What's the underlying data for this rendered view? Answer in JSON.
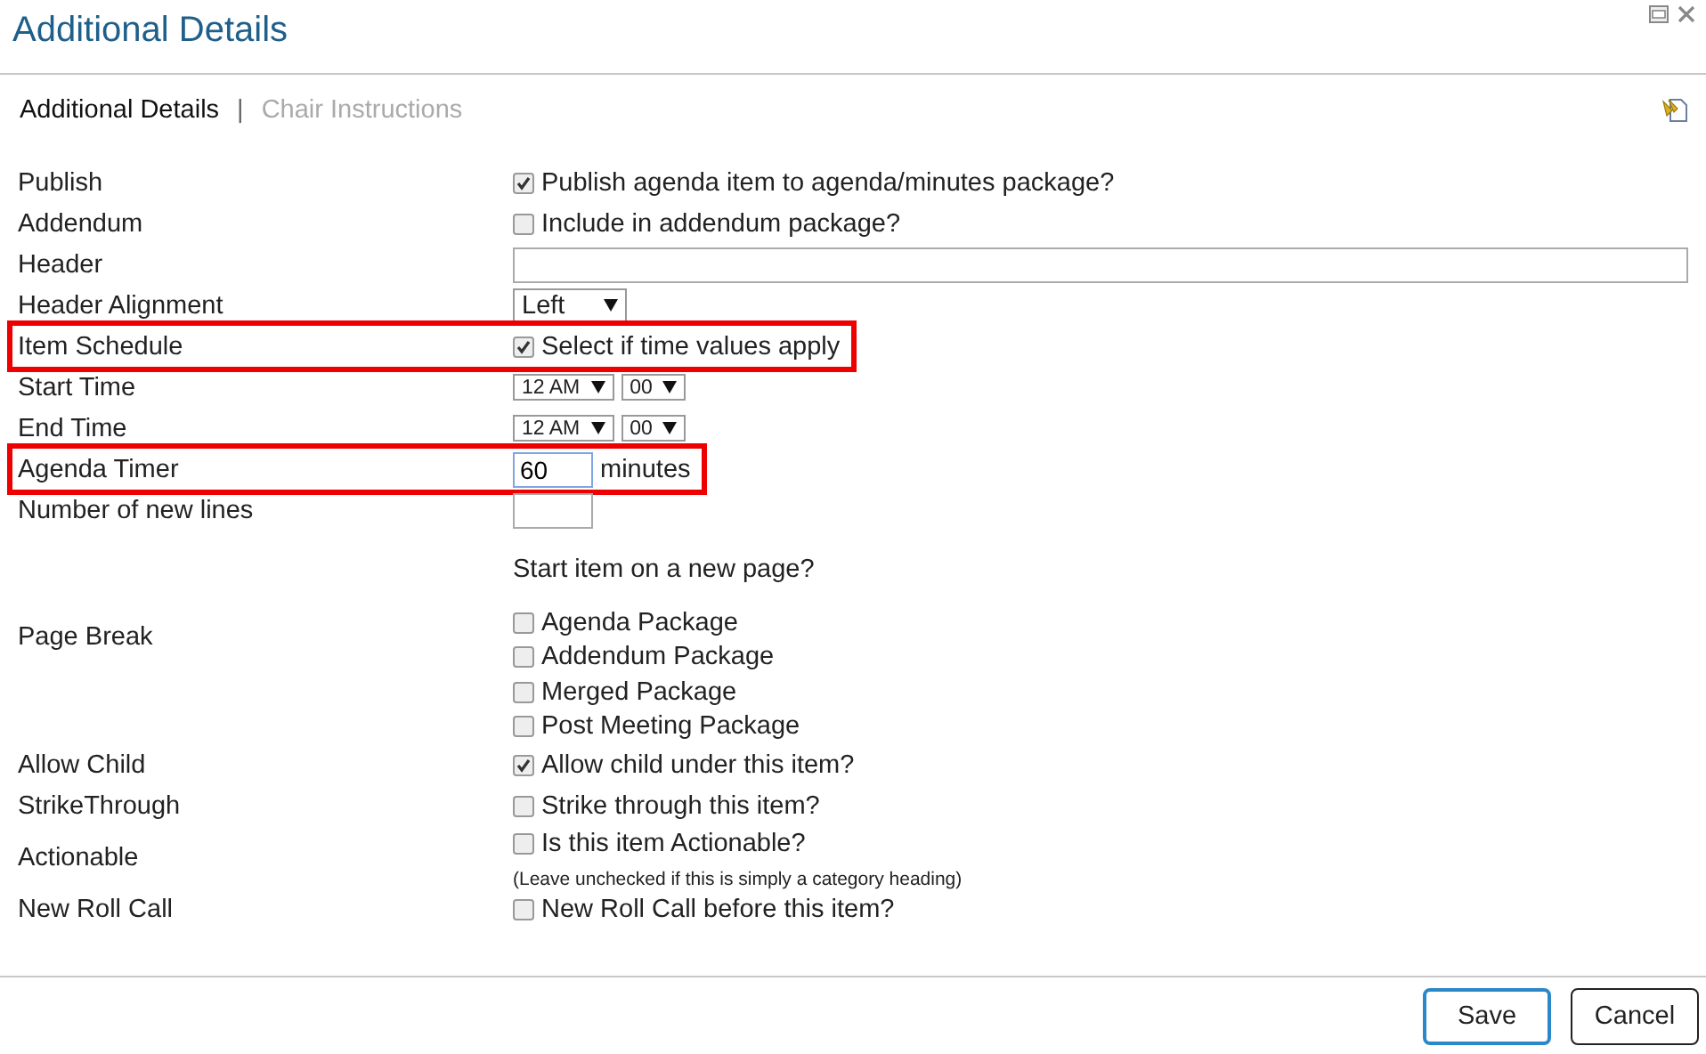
{
  "window": {
    "title": "Additional Details"
  },
  "tabs": [
    {
      "label": "Additional Details",
      "selected": true
    },
    {
      "label": "Chair Instructions",
      "selected": false
    }
  ],
  "tab_separator": "|",
  "rows": [
    {
      "kind": "checkbox",
      "label": "Publish",
      "text": "Publish agenda item to agenda/minutes package?",
      "checked": true,
      "highlighted": false
    },
    {
      "kind": "checkbox",
      "label": "Addendum",
      "text": "Include in addendum package?",
      "checked": false,
      "highlighted": false
    },
    {
      "kind": "wide-input",
      "label": "Header",
      "highlighted": false
    },
    {
      "kind": "select",
      "label": "Header Alignment",
      "value": "Left",
      "highlighted": false
    },
    {
      "kind": "checkbox",
      "label": "Item Schedule",
      "text": "Select if time values apply",
      "checked": true,
      "highlighted": true
    },
    {
      "kind": "time",
      "label": "Start Time",
      "hour": "12 AM",
      "minute": "00",
      "highlighted": false
    },
    {
      "kind": "time",
      "label": "End Time",
      "hour": "12 AM",
      "minute": "00",
      "highlighted": false
    },
    {
      "kind": "number",
      "label": "Agenda Timer",
      "value": "60",
      "suffix": "minutes",
      "focused": true,
      "highlighted": true
    },
    {
      "kind": "number",
      "label": "Number of new lines",
      "focused": false,
      "highlighted": false
    },
    {
      "kind": "checklist",
      "label": "Page Break",
      "prompt": "Start item on a new page?",
      "highlighted": false,
      "options": [
        {
          "text": "Agenda Package",
          "checked": false
        },
        {
          "text": "Addendum Package",
          "checked": false
        },
        {
          "text": "Merged Package",
          "checked": false
        },
        {
          "text": "Post Meeting Package",
          "checked": false
        }
      ]
    },
    {
      "kind": "checkbox",
      "label": "Allow Child",
      "text": "Allow child under this item?",
      "checked": true,
      "highlighted": false
    },
    {
      "kind": "checkbox",
      "label": "StrikeThrough",
      "text": "Strike through this item?",
      "checked": false,
      "highlighted": false
    },
    {
      "kind": "checkbox",
      "label": "Actionable",
      "text": "Is this item Actionable?",
      "note": "(Leave unchecked if this is simply a category heading)",
      "checked": false,
      "highlighted": false
    },
    {
      "kind": "checkbox",
      "label": "New Roll Call",
      "text": "New Roll Call before this item?",
      "checked": false,
      "highlighted": false
    }
  ],
  "buttons": [
    {
      "label": "Save",
      "primary": true
    },
    {
      "label": "Cancel",
      "primary": false
    }
  ]
}
